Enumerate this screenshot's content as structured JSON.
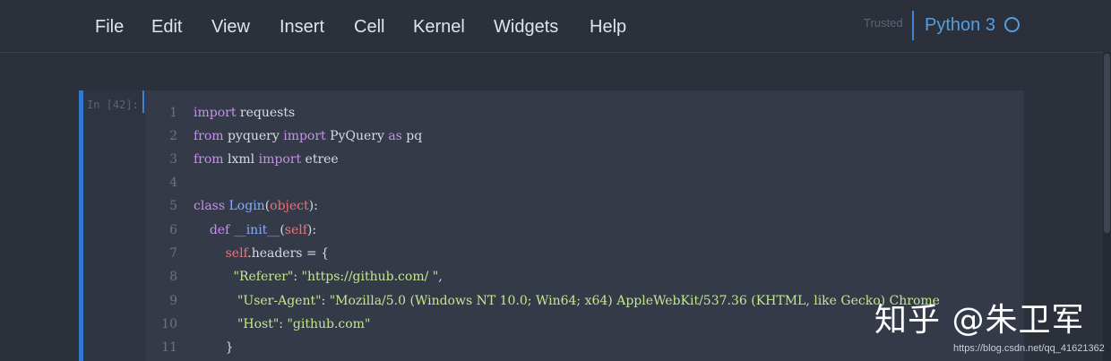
{
  "menu": {
    "items": [
      "File",
      "Edit",
      "View",
      "Insert",
      "Cell",
      "Kernel",
      "Widgets",
      "Help"
    ],
    "trusted": "Trusted",
    "kernel_name": "Python 3",
    "kernel_indicator": "circle-icon"
  },
  "cell": {
    "prompt": "In [42]:",
    "line_numbers": [
      "1",
      "2",
      "3",
      "4",
      "5",
      "6",
      "7",
      "8",
      "9",
      "10",
      "11"
    ]
  },
  "code": {
    "l1": {
      "kw": "import",
      "rest": " requests"
    },
    "l2": {
      "from": "from",
      "mod": " pyquery ",
      "imp": "import",
      "name": " PyQuery ",
      "as": "as",
      "alias": " pq"
    },
    "l3": {
      "from": "from",
      "mod": " lxml ",
      "imp": "import",
      "name": " etree"
    },
    "l5": {
      "kw": "class",
      "name": "Login",
      "open": "(",
      "base": "object",
      "close": "):"
    },
    "l6": {
      "indent": "    ",
      "kw": "def",
      "name": " __init__",
      "open": "(",
      "self": "self",
      "close": "):"
    },
    "l7": {
      "indent": "        ",
      "self": "self",
      "rest": ".headers = {"
    },
    "l8": {
      "indent": "          ",
      "key": "\"Referer\"",
      "colon": ": ",
      "val": "\"https://github.com/ \"",
      "comma": ","
    },
    "l9": {
      "indent": "           ",
      "key": "\"User-Agent\"",
      "colon": ": ",
      "val": "\"Mozilla/5.0 (Windows NT 10.0; Win64; x64) AppleWebKit/537.36 (KHTML, like Gecko) Chrome"
    },
    "l10": {
      "indent": "           ",
      "key": "\"Host\"",
      "colon": ": ",
      "val": "\"github.com\""
    },
    "l11": {
      "indent": "        ",
      "rest": "}"
    }
  },
  "watermark": {
    "text": "知乎 @朱卫军",
    "url": "https://blog.csdn.net/qq_41621362"
  }
}
